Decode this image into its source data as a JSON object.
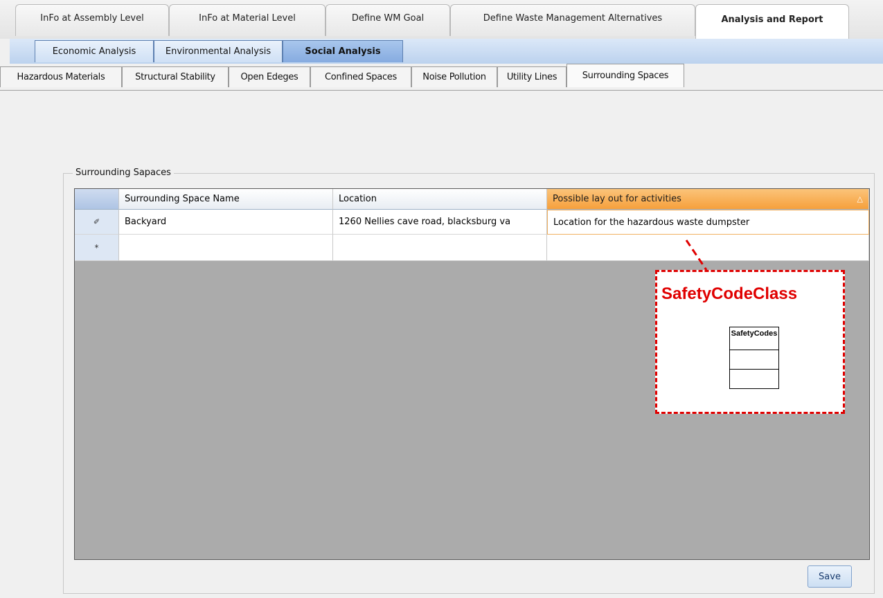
{
  "top_tabs": [
    {
      "label": "InFo at Assembly Level",
      "active": false
    },
    {
      "label": "InFo at Material Level",
      "active": false
    },
    {
      "label": "Define WM Goal",
      "active": false
    },
    {
      "label": "Define Waste Management Alternatives",
      "active": false
    },
    {
      "label": "Analysis and Report",
      "active": true
    }
  ],
  "sub_tabs": [
    {
      "label": "Economic Analysis",
      "active": false
    },
    {
      "label": "Environmental Analysis",
      "active": false
    },
    {
      "label": "Social Analysis",
      "active": true
    }
  ],
  "social_tabs": [
    {
      "label": "Hazardous Materials",
      "active": false
    },
    {
      "label": "Structural Stability",
      "active": false
    },
    {
      "label": "Open Edeges",
      "active": false
    },
    {
      "label": "Confined Spaces",
      "active": false
    },
    {
      "label": "Noise Pollution",
      "active": false
    },
    {
      "label": "Utility Lines",
      "active": false
    },
    {
      "label": "Surrounding Spaces",
      "active": true
    }
  ],
  "group": {
    "title": "Surrounding Sapaces"
  },
  "grid": {
    "columns": [
      "Surrounding Space Name",
      "Location",
      "Possible lay out for activities"
    ],
    "sort_indicator": "△",
    "edit_row_marker": "✐",
    "new_row_marker": "*",
    "rows": [
      [
        "Backyard",
        "1260 Nellies cave road, blacksburg va",
        "Location for the hazardous waste dumpster"
      ]
    ]
  },
  "annotation": {
    "title": "SafetyCodeClass",
    "class_name": "SafetyCodes",
    "color": "#e00000"
  },
  "save_label": "Save"
}
